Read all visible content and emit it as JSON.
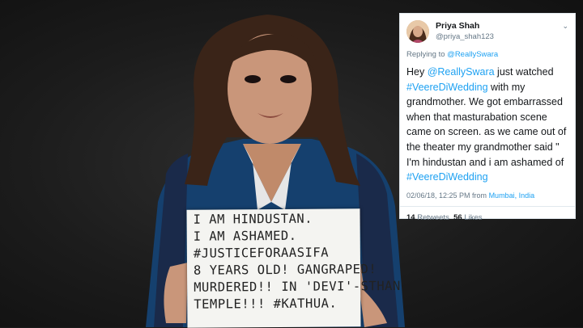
{
  "tweet": {
    "display_name": "Priya Shah",
    "handle": "@priya_shah123",
    "reply_prefix": "Replying to",
    "reply_handle": "@ReallySwara",
    "body": {
      "p1": "Hey ",
      "mention": "@ReallySwara",
      "p2": " just watched ",
      "hashtag1": "#VeereDiWedding",
      "p3": " with my grandmother. We got embarrassed when that masturabation scene came on screen. as we came out of the theater my grandmother said \" I'm hindustan and i am ashamed of ",
      "hashtag2": "#VeereDiWedding"
    },
    "timestamp": "02/06/18, 12:25 PM from ",
    "location": "Mumbai, India",
    "retweets_count": "14",
    "retweets_label": "Retweets",
    "likes_count": "56",
    "likes_label": "Likes",
    "chevron_icon": "chevron-down-icon",
    "link_color": "#1da1f2"
  },
  "sign": {
    "lines": [
      "I AM HINDUSTAN.",
      "I AM ASHAMED.",
      "#JUSTICEFORAASIFA",
      "8 YEARS OLD! GANGRAPED!",
      "MURDERED!! IN 'DEVI'-STHAN",
      "TEMPLE!!! #KATHUA."
    ]
  }
}
